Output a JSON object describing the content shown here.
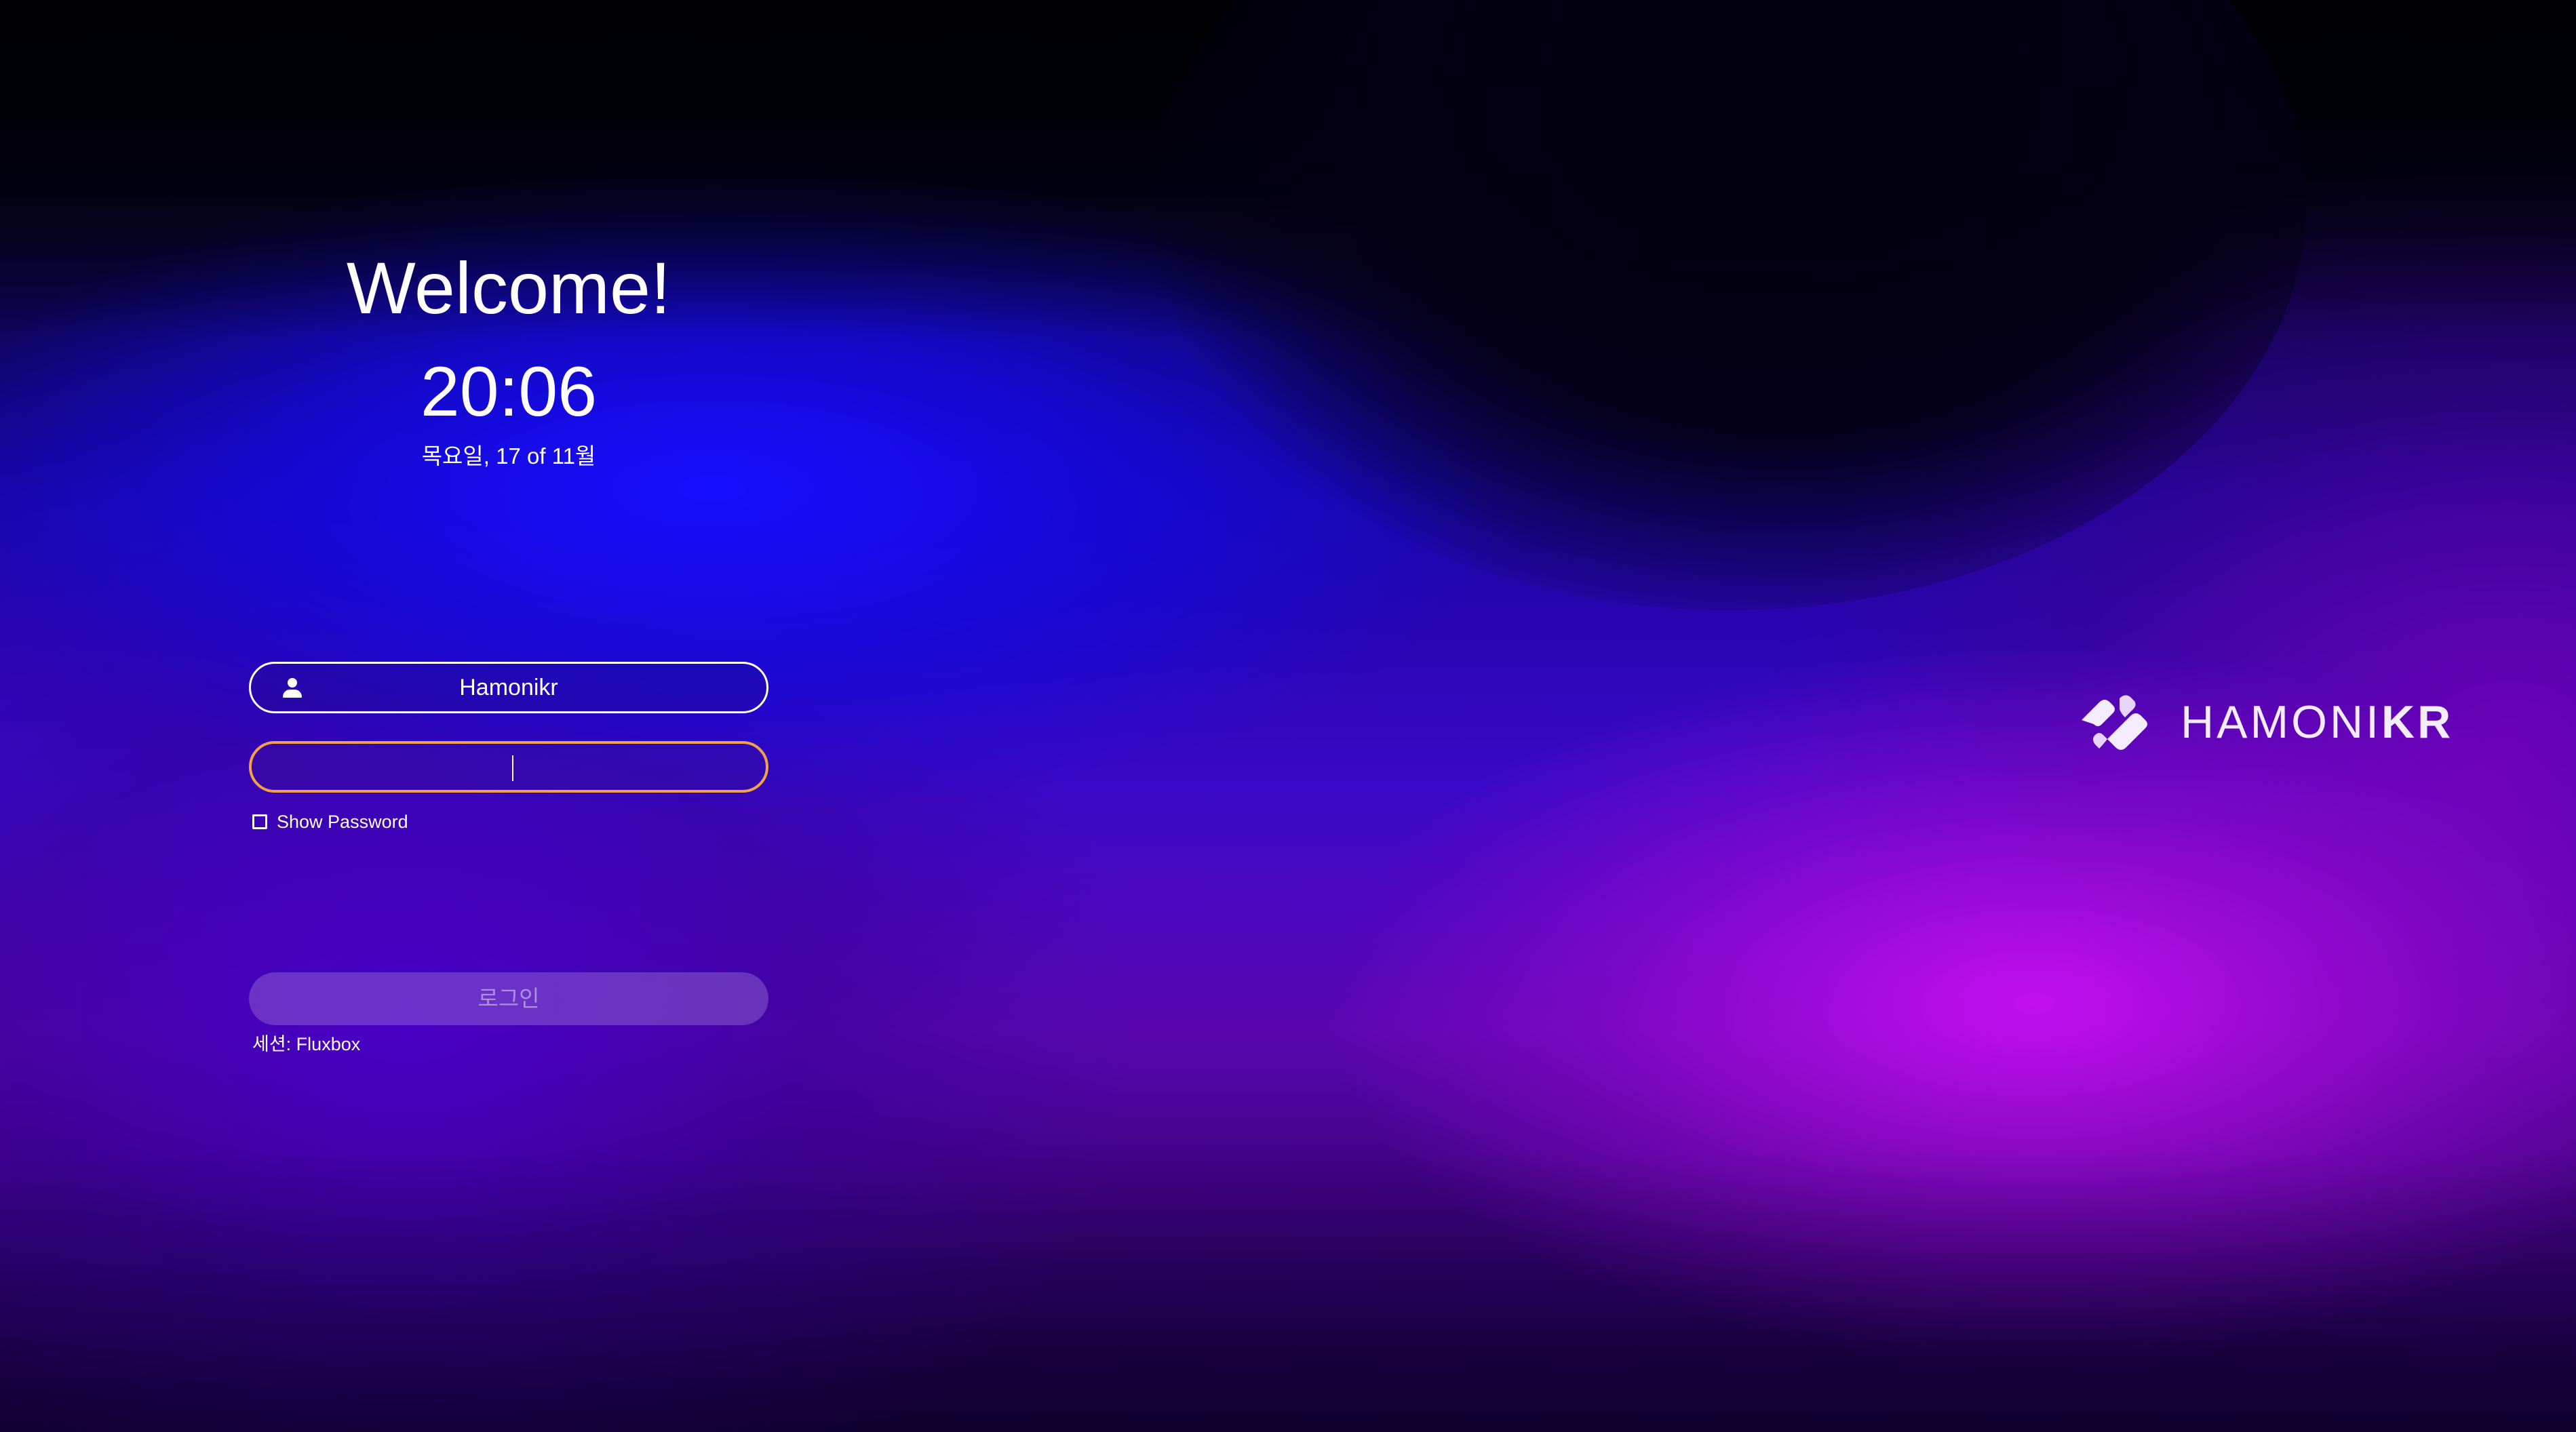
{
  "greeting": "Welcome!",
  "clock": {
    "time": "20:06",
    "date": "목요일, 17 of 11월"
  },
  "login_form": {
    "username": "Hamonikr",
    "password": "",
    "show_password_label": "Show Password",
    "show_password_checked": false,
    "login_button_label": "로그인",
    "session_label": "세션: Fluxbox"
  },
  "branding": {
    "logo_text_main": "HAMONI",
    "logo_text_suffix": "KR",
    "logo_icon": "hamonikr-logo-icon"
  },
  "colors": {
    "password_focus_border": "#f2a04a",
    "text": "#ffffff",
    "login_button_fill": "#966ed2"
  },
  "icons": {
    "username": "user-icon",
    "show_password": "checkbox-icon"
  }
}
